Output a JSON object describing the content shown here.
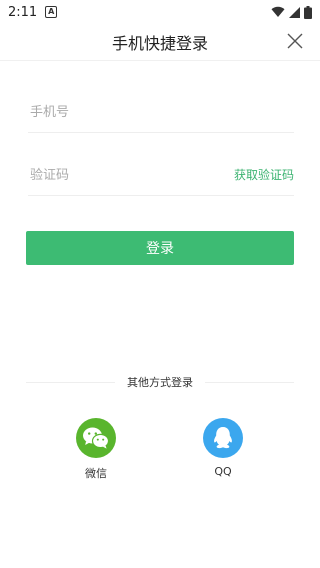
{
  "status_bar": {
    "time": "2:11",
    "notification_letter": "A"
  },
  "header": {
    "title": "手机快捷登录"
  },
  "form": {
    "phone_placeholder": "手机号",
    "code_placeholder": "验证码",
    "get_code_label": "获取验证码",
    "login_label": "登录"
  },
  "other_login": {
    "title": "其他方式登录",
    "options": [
      {
        "label": "微信",
        "icon": "wechat-icon",
        "color": "#59b52d"
      },
      {
        "label": "QQ",
        "icon": "qq-icon",
        "color": "#3ba7ee"
      }
    ]
  }
}
